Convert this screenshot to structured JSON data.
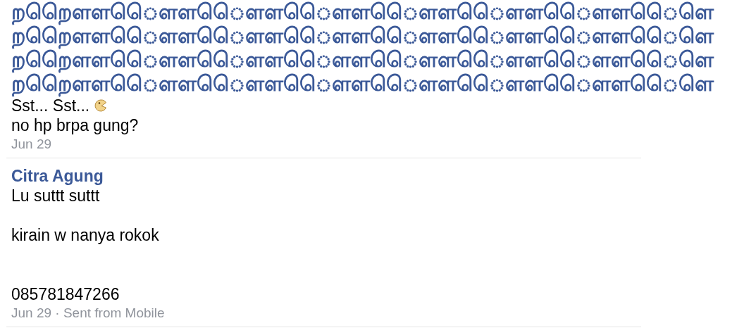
{
  "messages": [
    {
      "tamil_lines": [
        "றறெெளள◌ெெளள◌ெெளள◌ெெளள◌ெெளள◌ெெளள◌ெெளள◌ெெளெ",
        "றறெெளள◌ெெளள◌ெெளள◌ெெளள◌ெெளள◌ெெளள◌ெெளள◌ெெளெ",
        "றறெெளள◌ெெளள◌ெெளள◌ெெளள◌ெெளள◌ெெளள◌ெெளள◌ெெளெ",
        "றறெெளள◌ெெளள◌ெெளள◌ெெளள◌ெெளள◌ெெளள◌ெெளள◌ெெளெ"
      ],
      "body": [
        {
          "text": "Sst... Sst...",
          "emoticon": true
        },
        {
          "text": "no hp brpa gung?",
          "emoticon": false
        }
      ],
      "meta": "Jun 29"
    },
    {
      "author": "Citra Agung",
      "body": [
        {
          "text": "Lu suttt suttt\n\nkirain w nanya rokok\n\n\n085781847266",
          "emoticon": false
        }
      ],
      "meta": "Jun 29 · Sent from Mobile"
    }
  ]
}
